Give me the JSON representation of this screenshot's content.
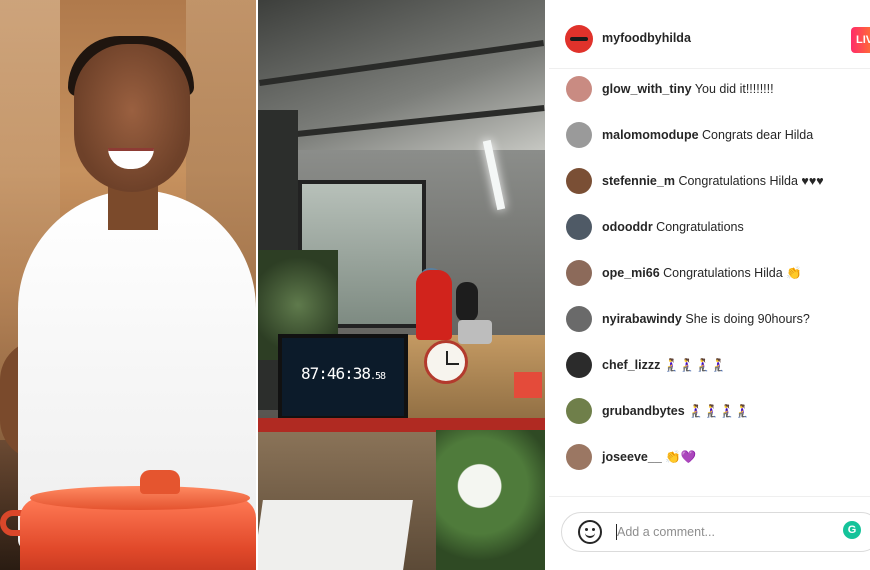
{
  "live_post": {
    "username": "myfoodbyhilda",
    "live_badge": "LIV"
  },
  "video": {
    "timer_main": "87:46:38",
    "timer_fraction": ".58"
  },
  "comments": [
    {
      "user": "glow_with_tiny",
      "text": "You did it!!!!!!!!",
      "avatar_color": "#c98b82"
    },
    {
      "user": "malomomodupe",
      "text": "Congrats dear Hilda",
      "avatar_color": "#9a9a9a"
    },
    {
      "user": "stefennie_m",
      "text": "Congratulations Hilda ♥♥♥",
      "avatar_color": "#7a4f35"
    },
    {
      "user": "odooddr",
      "text": "Congratulations",
      "avatar_color": "#4f5a66"
    },
    {
      "user": "ope_mi66",
      "text": "Congratulations Hilda 👏",
      "avatar_color": "#8c6a5a"
    },
    {
      "user": "nyirabawindy",
      "text": "She is doing 90hours?",
      "avatar_color": "#6a6a6a"
    },
    {
      "user": "chef_lizzz",
      "text": "🧎‍♀️🧎‍♀️🧎‍♀️🧎‍♀️",
      "avatar_color": "#2b2b2b"
    },
    {
      "user": "grubandbytes",
      "text": "🧎‍♀️🧎‍♀️🧎‍♀️🧎‍♀️",
      "avatar_color": "#6f7f4a"
    },
    {
      "user": "joseeve__",
      "text": "👏💜",
      "avatar_color": "#9b7763"
    }
  ],
  "comment_box": {
    "placeholder": "Add a comment..."
  }
}
